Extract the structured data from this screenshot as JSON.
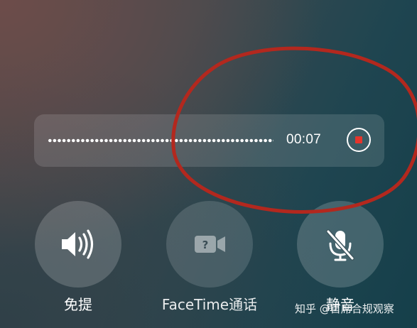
{
  "recording": {
    "elapsed_time": "00:07",
    "waveform_icon": "waveform-dots",
    "stop_icon": "stop-square-icon",
    "stop_color": "#e5352c"
  },
  "actions": [
    {
      "id": "speaker",
      "label": "免提",
      "icon": "speaker-icon"
    },
    {
      "id": "facetime",
      "label": "FaceTime通话",
      "icon": "facetime-video-icon"
    },
    {
      "id": "mute",
      "label": "静音",
      "icon": "mic-off-icon"
    }
  ],
  "annotation": {
    "shape": "ellipse",
    "color": "#b3281e"
  },
  "watermark": {
    "text": "知乎 @首席合规观察"
  }
}
